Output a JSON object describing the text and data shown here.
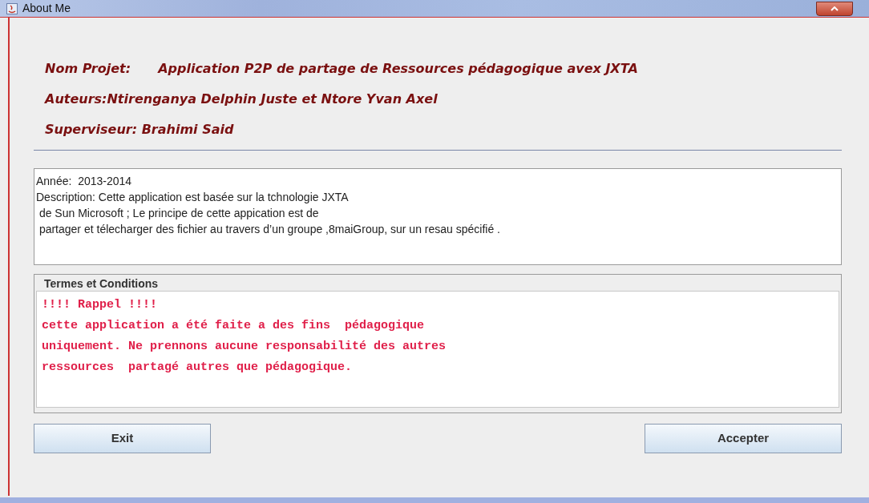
{
  "window": {
    "title": "About Me"
  },
  "header": [
    {
      "label": "Nom Projet:",
      "value": "Application P2P de partage de Ressources pédagogique avex JXTA"
    },
    {
      "label": "Auteurs:Ntirenganya Delphin Juste et Ntore Yvan Axel"
    },
    {
      "label": "Superviseur: Brahimi Said"
    }
  ],
  "description": {
    "lines": [
      "Année:  2013-2014",
      "Description: Cette application est basée sur la tchnologie JXTA",
      " de Sun Microsoft ; Le principe de cette appication est de",
      " partager et télecharger des fichier au travers d’un groupe ,8maiGroup, sur un resau spécifié ."
    ]
  },
  "terms": {
    "title": "Termes et Conditions",
    "lines": [
      "!!!! Rappel !!!!",
      "cette application a été faite a des fins  pédagogique",
      "uniquement. Ne prennons aucune responsabilité des autres",
      "ressources  partagé autres que pédagogique."
    ]
  },
  "buttons": [
    {
      "label": "Exit",
      "kind": "left"
    },
    {
      "label": "Accepter",
      "kind": "right"
    }
  ]
}
